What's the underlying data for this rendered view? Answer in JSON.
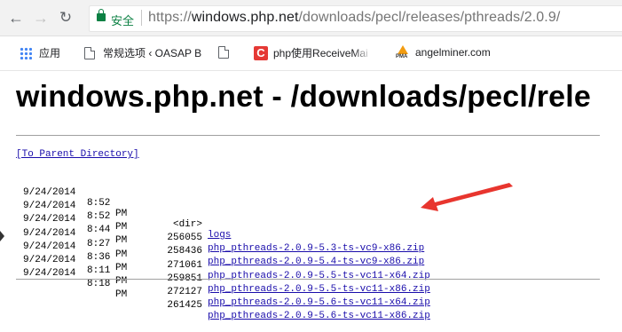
{
  "browser": {
    "secure_label": "安全",
    "url_prefix": "https://",
    "url_host": "windows.php.net",
    "url_path": "/downloads/pecl/releases/pthreads/2.0.9/"
  },
  "bookmarks": [
    {
      "label": "应用",
      "icon": "apps-grid-icon"
    },
    {
      "label": "常规选项 ‹ OASAP B",
      "icon": "page-icon"
    },
    {
      "label": "",
      "icon": "page-icon"
    },
    {
      "label": "php使用ReceiveMai",
      "icon": "c-logo-icon"
    },
    {
      "label": "angelminer.com",
      "icon": "pma-logo-icon"
    }
  ],
  "page": {
    "title": "windows.php.net - /downloads/pecl/rele",
    "parent_link": "[To Parent Directory]",
    "entries": [
      {
        "date": "9/24/2014",
        "time": "8:52",
        "ampm": "PM",
        "size": "<dir>",
        "name": "logs"
      },
      {
        "date": "9/24/2014",
        "time": "8:52",
        "ampm": "PM",
        "size": "256055",
        "name": "php_pthreads-2.0.9-5.3-ts-vc9-x86.zip"
      },
      {
        "date": "9/24/2014",
        "time": "8:44",
        "ampm": "PM",
        "size": "258436",
        "name": "php_pthreads-2.0.9-5.4-ts-vc9-x86.zip"
      },
      {
        "date": "9/24/2014",
        "time": "8:27",
        "ampm": "PM",
        "size": "271061",
        "name": "php_pthreads-2.0.9-5.5-ts-vc11-x64.zip"
      },
      {
        "date": "9/24/2014",
        "time": "8:36",
        "ampm": "PM",
        "size": "259851",
        "name": "php_pthreads-2.0.9-5.5-ts-vc11-x86.zip"
      },
      {
        "date": "9/24/2014",
        "time": "8:11",
        "ampm": "PM",
        "size": "272127",
        "name": "php_pthreads-2.0.9-5.6-ts-vc11-x64.zip"
      },
      {
        "date": "9/24/2014",
        "time": "8:18",
        "ampm": "PM",
        "size": "261425",
        "name": "php_pthreads-2.0.9-5.6-ts-vc11-x86.zip"
      }
    ]
  },
  "colors": {
    "link": "#1a0dab",
    "annotation_arrow": "#e8352e",
    "secure": "#0b8043"
  }
}
